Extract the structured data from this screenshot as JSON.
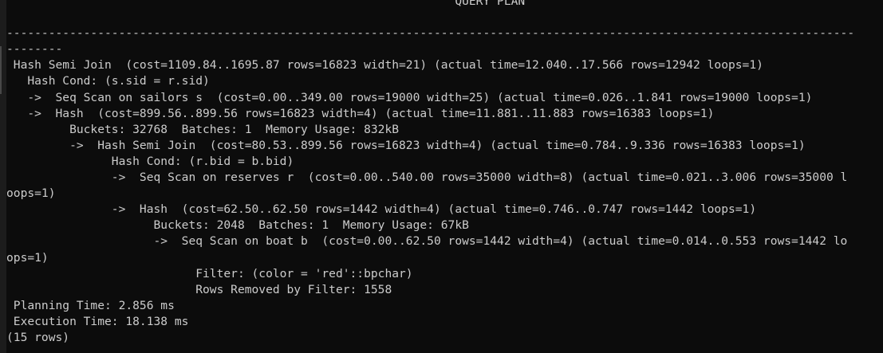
{
  "terminal": {
    "lines": [
      "                                                                QUERY PLAN",
      "",
      "-------------------------------------------------------------------------------------------------------------------------",
      "--------",
      " Hash Semi Join  (cost=1109.84..1695.87 rows=16823 width=21) (actual time=12.040..17.566 rows=12942 loops=1)",
      "   Hash Cond: (s.sid = r.sid)",
      "   ->  Seq Scan on sailors s  (cost=0.00..349.00 rows=19000 width=25) (actual time=0.026..1.841 rows=19000 loops=1)",
      "   ->  Hash  (cost=899.56..899.56 rows=16823 width=4) (actual time=11.881..11.883 rows=16383 loops=1)",
      "         Buckets: 32768  Batches: 1  Memory Usage: 832kB",
      "         ->  Hash Semi Join  (cost=80.53..899.56 rows=16823 width=4) (actual time=0.784..9.336 rows=16383 loops=1)",
      "               Hash Cond: (r.bid = b.bid)",
      "               ->  Seq Scan on reserves r  (cost=0.00..540.00 rows=35000 width=8) (actual time=0.021..3.006 rows=35000 l",
      "oops=1)",
      "               ->  Hash  (cost=62.50..62.50 rows=1442 width=4) (actual time=0.746..0.747 rows=1442 loops=1)",
      "                     Buckets: 2048  Batches: 1  Memory Usage: 67kB",
      "                     ->  Seq Scan on boat b  (cost=0.00..62.50 rows=1442 width=4) (actual time=0.014..0.553 rows=1442 lo",
      "ops=1)",
      "                           Filter: (color = 'red'::bpchar)",
      "                           Rows Removed by Filter: 1558",
      " Planning Time: 2.856 ms",
      " Execution Time: 18.138 ms",
      "(15 rows)"
    ]
  }
}
